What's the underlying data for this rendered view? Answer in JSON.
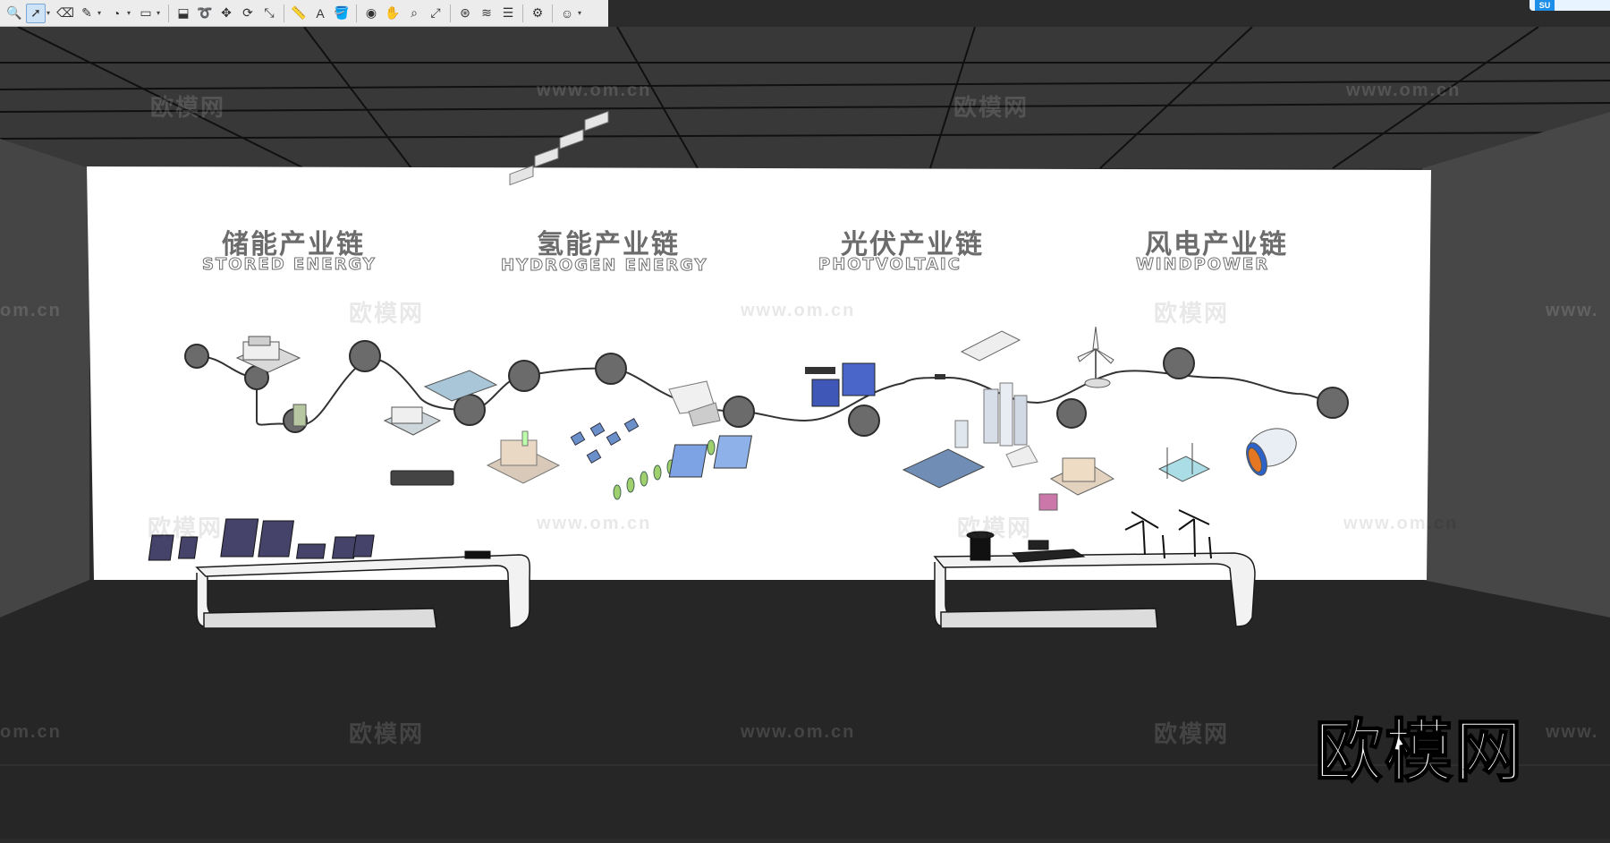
{
  "toolbar": {
    "tools": [
      {
        "name": "zoom-tool-icon",
        "glyph": "🔍"
      },
      {
        "name": "select-tool-icon",
        "glyph": "➚",
        "active": true,
        "dropdown": true
      },
      {
        "name": "eraser-tool-icon",
        "glyph": "⌫"
      },
      {
        "name": "pencil-tool-icon",
        "glyph": "✎",
        "dropdown": true
      },
      {
        "name": "arc-tool-icon",
        "glyph": "◔",
        "dropdown": true
      },
      {
        "name": "rectangle-tool-icon",
        "glyph": "▭",
        "dropdown": true
      },
      {
        "sep": true
      },
      {
        "name": "push-pull-tool-icon",
        "glyph": "⬓"
      },
      {
        "name": "follow-me-tool-icon",
        "glyph": "➰"
      },
      {
        "name": "move-tool-icon",
        "glyph": "✥"
      },
      {
        "name": "rotate-tool-icon",
        "glyph": "⟳"
      },
      {
        "name": "scale-tool-icon",
        "glyph": "⤡"
      },
      {
        "sep": true
      },
      {
        "name": "tape-measure-tool-icon",
        "glyph": "📏"
      },
      {
        "name": "text-tool-icon",
        "glyph": "A"
      },
      {
        "name": "paint-bucket-tool-icon",
        "glyph": "🪣"
      },
      {
        "sep": true
      },
      {
        "name": "orbit-tool-icon",
        "glyph": "◉"
      },
      {
        "name": "pan-tool-icon",
        "glyph": "✋"
      },
      {
        "name": "zoom-window-tool-icon",
        "glyph": "⌕"
      },
      {
        "name": "zoom-extents-tool-icon",
        "glyph": "⤢"
      },
      {
        "sep": true
      },
      {
        "name": "warehouse-icon",
        "glyph": "⊛"
      },
      {
        "name": "extension-warehouse-icon",
        "glyph": "≋"
      },
      {
        "name": "layout-icon",
        "glyph": "☰"
      },
      {
        "sep": true
      },
      {
        "name": "extension-manager-icon",
        "glyph": "⚙"
      },
      {
        "sep": true
      },
      {
        "name": "account-icon",
        "glyph": "☺",
        "dropdown": true
      }
    ],
    "caret": "▾"
  },
  "corner_badge": "SU",
  "brand_logo": "欧模网",
  "watermarks": {
    "cn": "欧模网",
    "url": "www.om.cn",
    "url_partial": "om.cn",
    "url_cut": "www."
  },
  "colors": {
    "ceiling": "#3a3a3a",
    "side_wall": "#454545",
    "floor": "#262626",
    "screen": "#ffffff",
    "accent_blue": "#1d8fe8",
    "node_gray": "#666666"
  },
  "panels": [
    {
      "cn": "储能产业链",
      "en": "STORED ENERGY"
    },
    {
      "cn": "氢能产业链",
      "en": "HYDROGEN ENERGY"
    },
    {
      "cn": "光伏产业链",
      "en": "PHOTVOLTAIC"
    },
    {
      "cn": "风电产业链",
      "en": "WINDPOWER"
    }
  ]
}
